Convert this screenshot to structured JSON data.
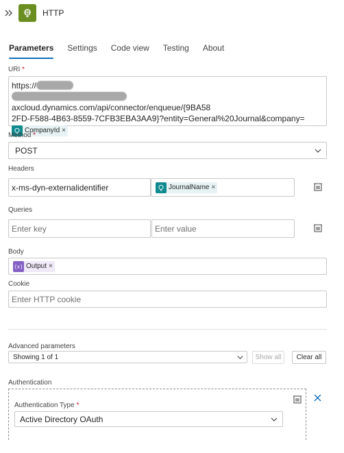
{
  "header": {
    "title": "HTTP",
    "collapse_icon": "chevron-double-right-icon",
    "action_icon": "globe-icon",
    "action_color": "#6b8e23"
  },
  "tabs": [
    {
      "label": "Parameters",
      "active": true
    },
    {
      "label": "Settings",
      "active": false
    },
    {
      "label": "Code view",
      "active": false
    },
    {
      "label": "Testing",
      "active": false
    },
    {
      "label": "About",
      "active": false
    }
  ],
  "uri": {
    "label": "URI",
    "required_mark": "*",
    "line1_prefix": "https://",
    "line2_suffix": "axcloud.dynamics.com/api/connector/enqueue/{9BA58",
    "line3": "2FD-F588-4B63-8559-7CFB3EBA3AA9}?entity=General%20Journal&company=",
    "token": "CompanyId",
    "token_remove": "×"
  },
  "method": {
    "label": "Method",
    "required_mark": "*",
    "value": "POST"
  },
  "headers": {
    "label": "Headers",
    "key": "x-ms-dyn-externalidentifier",
    "value_token": "JournalName",
    "token_remove": "×"
  },
  "queries": {
    "label": "Queries",
    "key_placeholder": "Enter key",
    "value_placeholder": "Enter value"
  },
  "body": {
    "label": "Body",
    "token": "Output",
    "token_remove": "×"
  },
  "cookie": {
    "label": "Cookie",
    "placeholder": "Enter HTTP cookie"
  },
  "advanced": {
    "label": "Advanced parameters",
    "value": "Showing 1 of 1",
    "show_all": "Show all",
    "clear_all": "Clear all"
  },
  "authentication": {
    "label": "Authentication",
    "type_label": "Authentication Type",
    "required_mark": "*",
    "type_value": "Active Directory OAuth"
  },
  "colors": {
    "accent": "#0f6cbd",
    "required": "#c50f1f",
    "token_teal": "#0f8a8f",
    "token_purple": "#8661c5"
  }
}
